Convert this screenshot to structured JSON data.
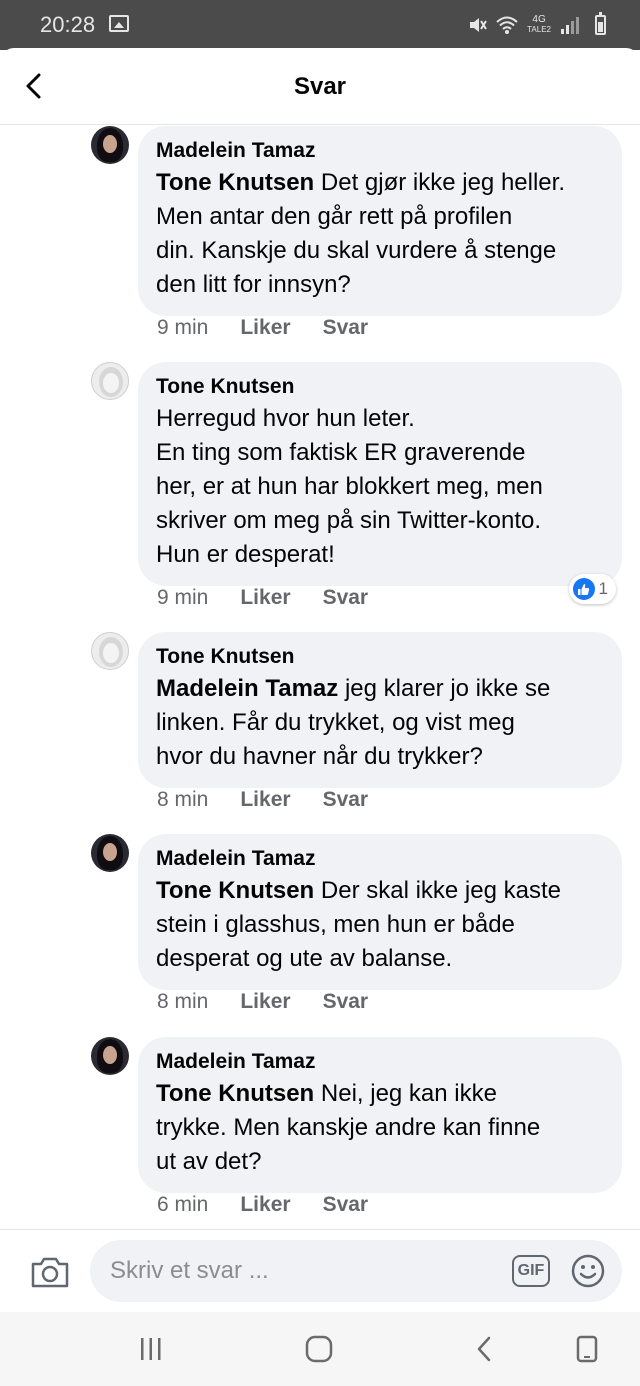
{
  "status_bar": {
    "time": "20:28",
    "network": "4G",
    "network_sub": "TALE2"
  },
  "header": {
    "title": "Svar"
  },
  "comments": [
    {
      "author": "Madelein Tamaz",
      "mention": "Tone Knutsen",
      "lines": [
        " Det gjør ikke jeg heller.",
        "Men antar den går rett på profilen",
        "din. Kanskje du skal vurdere å stenge",
        "den litt for innsyn?"
      ],
      "time": "9 min",
      "like": "Liker",
      "reply": "Svar"
    },
    {
      "author": "Tone Knutsen",
      "lines": [
        "Herregud hvor hun leter.",
        "En ting som faktisk ER graverende",
        "her, er at hun har blokkert meg, men",
        "skriver om meg på sin Twitter-konto.",
        "Hun er desperat!"
      ],
      "time": "9 min",
      "like": "Liker",
      "reply": "Svar",
      "reactions": {
        "count": "1"
      }
    },
    {
      "author": "Tone Knutsen",
      "mention": "Madelein Tamaz",
      "lines": [
        " jeg klarer jo ikke se",
        "linken. Får du trykket, og vist meg",
        "hvor du havner når du trykker?"
      ],
      "time": "8 min",
      "like": "Liker",
      "reply": "Svar"
    },
    {
      "author": "Madelein Tamaz",
      "mention": "Tone Knutsen",
      "lines": [
        " Der skal ikke jeg kaste",
        "stein i glasshus, men hun er både",
        "desperat og ute av balanse."
      ],
      "time": "8 min",
      "like": "Liker",
      "reply": "Svar"
    },
    {
      "author": "Madelein Tamaz",
      "mention": "Tone Knutsen",
      "lines": [
        " Nei, jeg kan ikke",
        "trykke. Men kanskje andre kan finne",
        "ut av det?"
      ],
      "time": "6 min",
      "like": "Liker",
      "reply": "Svar"
    }
  ],
  "composer": {
    "placeholder": "Skriv et svar ...",
    "gif_label": "GIF"
  },
  "icons": [
    "image-icon",
    "mute-icon",
    "wifi-icon",
    "signal-icon",
    "battery-icon",
    "back-arrow-icon",
    "like-icon",
    "camera-icon",
    "emoji-icon",
    "recent-apps-icon",
    "home-icon",
    "back-icon",
    "rotate-icon"
  ],
  "colors": {
    "bubble": "#f0f2f5",
    "like_blue": "#1877f2",
    "meta_gray": "#65676b",
    "status_bar": "#4b4b4b"
  }
}
